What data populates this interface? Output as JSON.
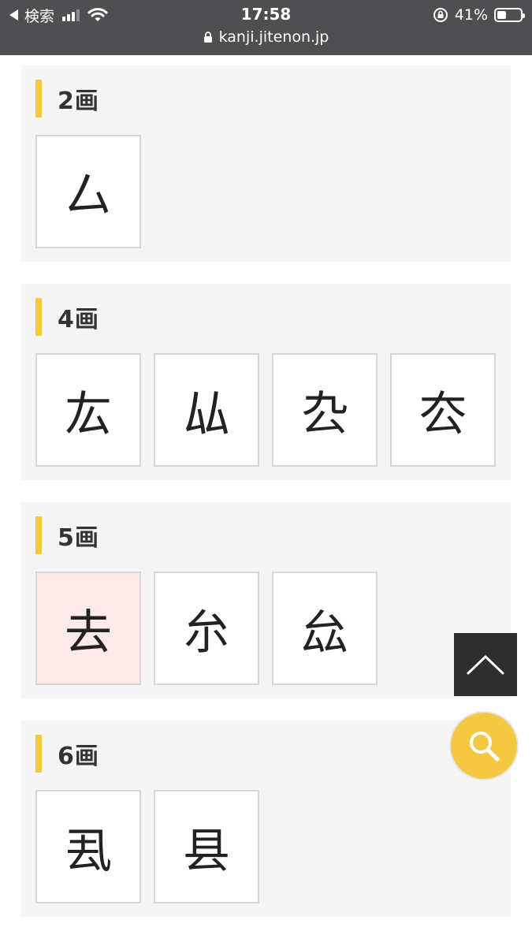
{
  "status_bar": {
    "back_label": "検索",
    "time": "17:58",
    "battery_percent": "41%",
    "battery_level": 0.41
  },
  "browser": {
    "url": "kanji.jitenon.jp"
  },
  "sections": [
    {
      "title": "2画",
      "kanji": [
        "厶"
      ],
      "highlighted_index": null
    },
    {
      "title": "4画",
      "kanji": [
        "厷",
        "厸",
        "厹",
        "厺"
      ],
      "highlighted_index": null
    },
    {
      "title": "5画",
      "kanji": [
        "去",
        "厼",
        "厽"
      ],
      "highlighted_index": 0
    },
    {
      "title": "6画",
      "kanji": [
        "厾",
        "县"
      ],
      "highlighted_index": null
    }
  ],
  "colors": {
    "accent_bar": "#f5c842",
    "highlight_tile": "#fde8ea",
    "search_button": "#f5c842",
    "to_top_button": "#2e2e2e"
  },
  "icons": {
    "to_top": "chevron-up-icon",
    "search": "search-icon"
  }
}
